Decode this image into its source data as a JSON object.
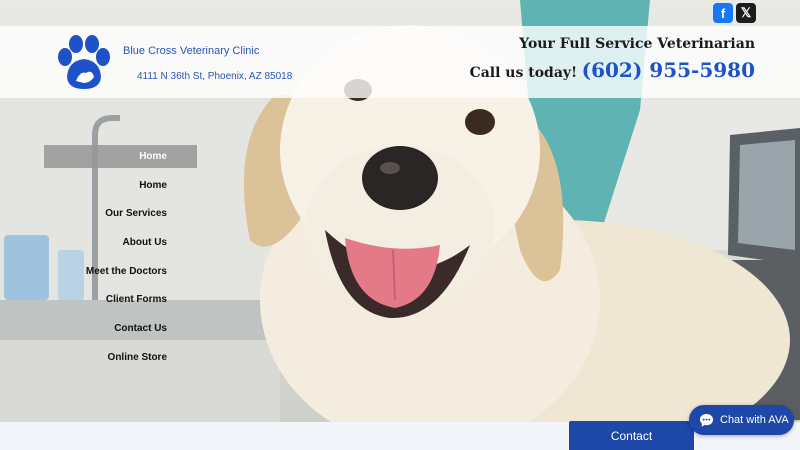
{
  "header": {
    "clinic_name": "Blue Cross Veterinary Clinic",
    "address": "4111 N 36th St, Phoenix, AZ 85018",
    "tagline": "Your Full Service Veterinarian",
    "call_label": "Call us today!",
    "phone": "(602) 955-5980"
  },
  "social": {
    "facebook": "f",
    "twitter": "𝕏"
  },
  "nav": {
    "items": [
      "Home",
      "Home",
      "Our Services",
      "About Us",
      "Meet the Doctors",
      "Client Forms",
      "Contact Us",
      "Online Store"
    ],
    "active_index": 0
  },
  "contact_tab": "Contact",
  "chat_label": "Chat with AVA",
  "colors": {
    "brand_blue": "#1d52c8",
    "button_blue": "#1d47a8",
    "facebook": "#1877f2"
  }
}
